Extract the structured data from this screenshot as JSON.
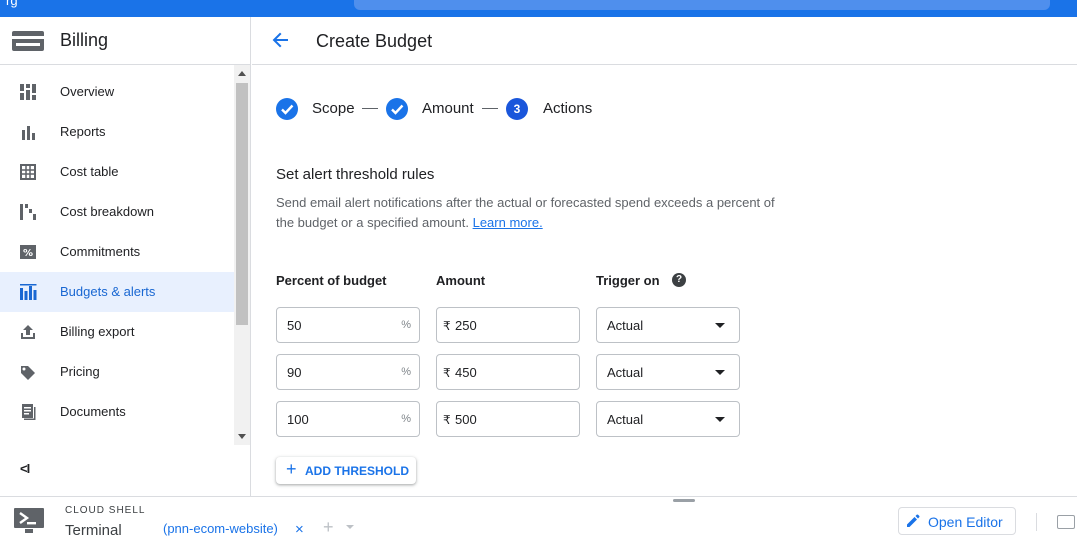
{
  "topbar": {
    "title_fragment": "rg"
  },
  "sidebar": {
    "title": "Billing",
    "items": [
      {
        "label": "Overview",
        "icon": "overview-icon"
      },
      {
        "label": "Reports",
        "icon": "reports-icon"
      },
      {
        "label": "Cost table",
        "icon": "table-icon"
      },
      {
        "label": "Cost breakdown",
        "icon": "breakdown-icon"
      },
      {
        "label": "Commitments",
        "icon": "percent-icon"
      },
      {
        "label": "Budgets & alerts",
        "icon": "budget-icon",
        "active": true
      },
      {
        "label": "Billing export",
        "icon": "export-icon"
      },
      {
        "label": "Pricing",
        "icon": "tag-icon"
      },
      {
        "label": "Documents",
        "icon": "document-icon"
      }
    ],
    "collapse_label": "<I"
  },
  "header": {
    "title": "Create Budget"
  },
  "stepper": {
    "steps": [
      {
        "label": "Scope",
        "state": "done"
      },
      {
        "label": "Amount",
        "state": "done"
      },
      {
        "label": "Actions",
        "state": "current",
        "number": "3"
      }
    ]
  },
  "section": {
    "title": "Set alert threshold rules",
    "description": "Send email alert notifications after the actual or forecasted spend exceeds a percent of the budget or a specified amount.",
    "learn_more": "Learn more."
  },
  "thresholds": {
    "headers": {
      "percent": "Percent of budget",
      "amount": "Amount",
      "trigger": "Trigger on"
    },
    "help": "?",
    "percent_suffix": "%",
    "currency": "₹",
    "rows": [
      {
        "percent": "50",
        "amount": "250",
        "trigger": "Actual"
      },
      {
        "percent": "90",
        "amount": "450",
        "trigger": "Actual"
      },
      {
        "percent": "100",
        "amount": "500",
        "trigger": "Actual"
      }
    ],
    "add_label": "ADD THRESHOLD"
  },
  "cloud_shell": {
    "section_label": "CLOUD SHELL",
    "terminal_label": "Terminal",
    "tab_label": "(pnn-ecom-website)",
    "tab_close": "×",
    "add_tab": "+",
    "open_editor": "Open Editor"
  },
  "colors": {
    "accent": "#1a73e8",
    "active_bg": "#e8f0fe",
    "border": "#dadce0"
  }
}
